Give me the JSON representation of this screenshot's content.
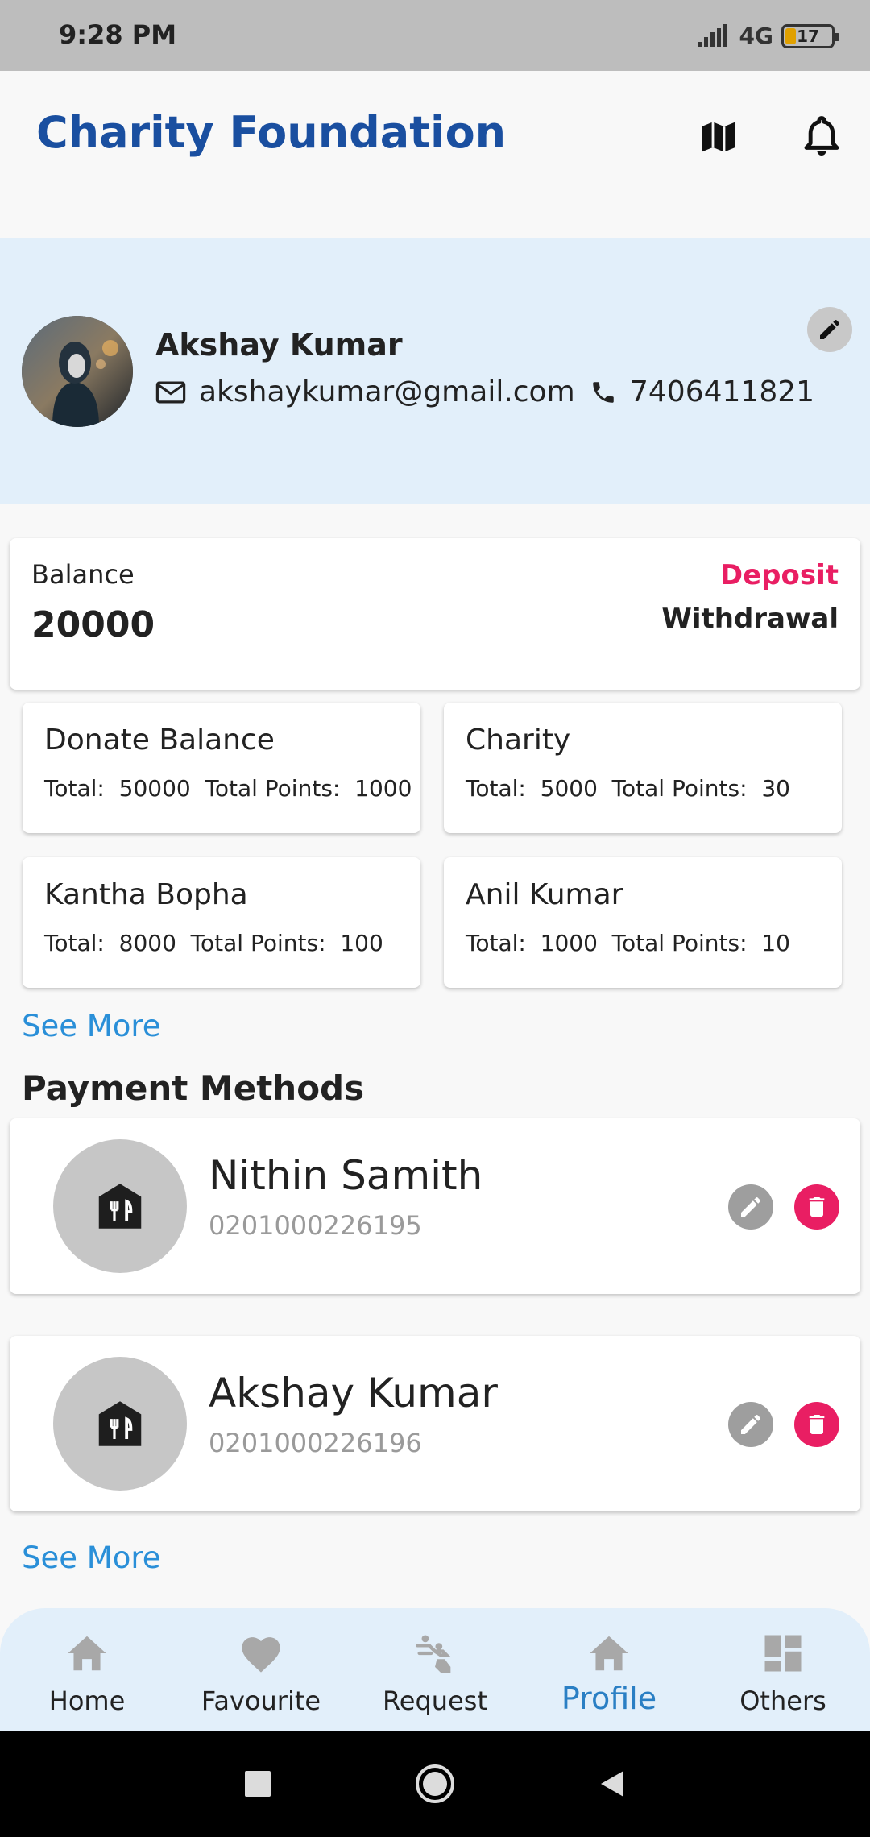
{
  "status_bar": {
    "time": "9:28 PM",
    "network": "4G",
    "battery": "17"
  },
  "header": {
    "title": "Charity Foundation",
    "icons": [
      "map-icon",
      "bell-icon"
    ]
  },
  "profile": {
    "name": "Akshay Kumar",
    "email": "akshaykumar@gmail.com",
    "phone": "7406411821"
  },
  "balance": {
    "label": "Balance",
    "value": "20000",
    "deposit_label": "Deposit",
    "withdrawal_label": "Withdrawal"
  },
  "stats": [
    {
      "title": "Donate Balance",
      "detail": "Total:  50000  Total Points:  1000"
    },
    {
      "title": "Charity",
      "detail": "Total:  5000  Total Points:  30"
    },
    {
      "title": "Kantha Bopha",
      "detail": "Total:  8000  Total Points:  100"
    },
    {
      "title": "Anil Kumar",
      "detail": "Total:  1000  Total Points:  10"
    }
  ],
  "see_more_label": "See More",
  "payment_methods": {
    "title": "Payment Methods",
    "items": [
      {
        "name": "Nithin Samith",
        "account": "0201000226195"
      },
      {
        "name": "Akshay Kumar",
        "account": "0201000226196"
      }
    ],
    "see_more_label": "See More"
  },
  "bottom_nav": {
    "active": "Profile",
    "items": [
      {
        "label": "Home",
        "icon": "home-icon"
      },
      {
        "label": "Favourite",
        "icon": "heart-icon"
      },
      {
        "label": "Request",
        "icon": "request-icon"
      },
      {
        "label": "Profile",
        "icon": "home-icon"
      },
      {
        "label": "Others",
        "icon": "dashboard-icon"
      }
    ]
  },
  "colors": {
    "brand_blue": "#1a4fa0",
    "accent_pink": "#e91e63",
    "link_blue": "#2a8fd8",
    "profile_band": "#e2effa"
  }
}
